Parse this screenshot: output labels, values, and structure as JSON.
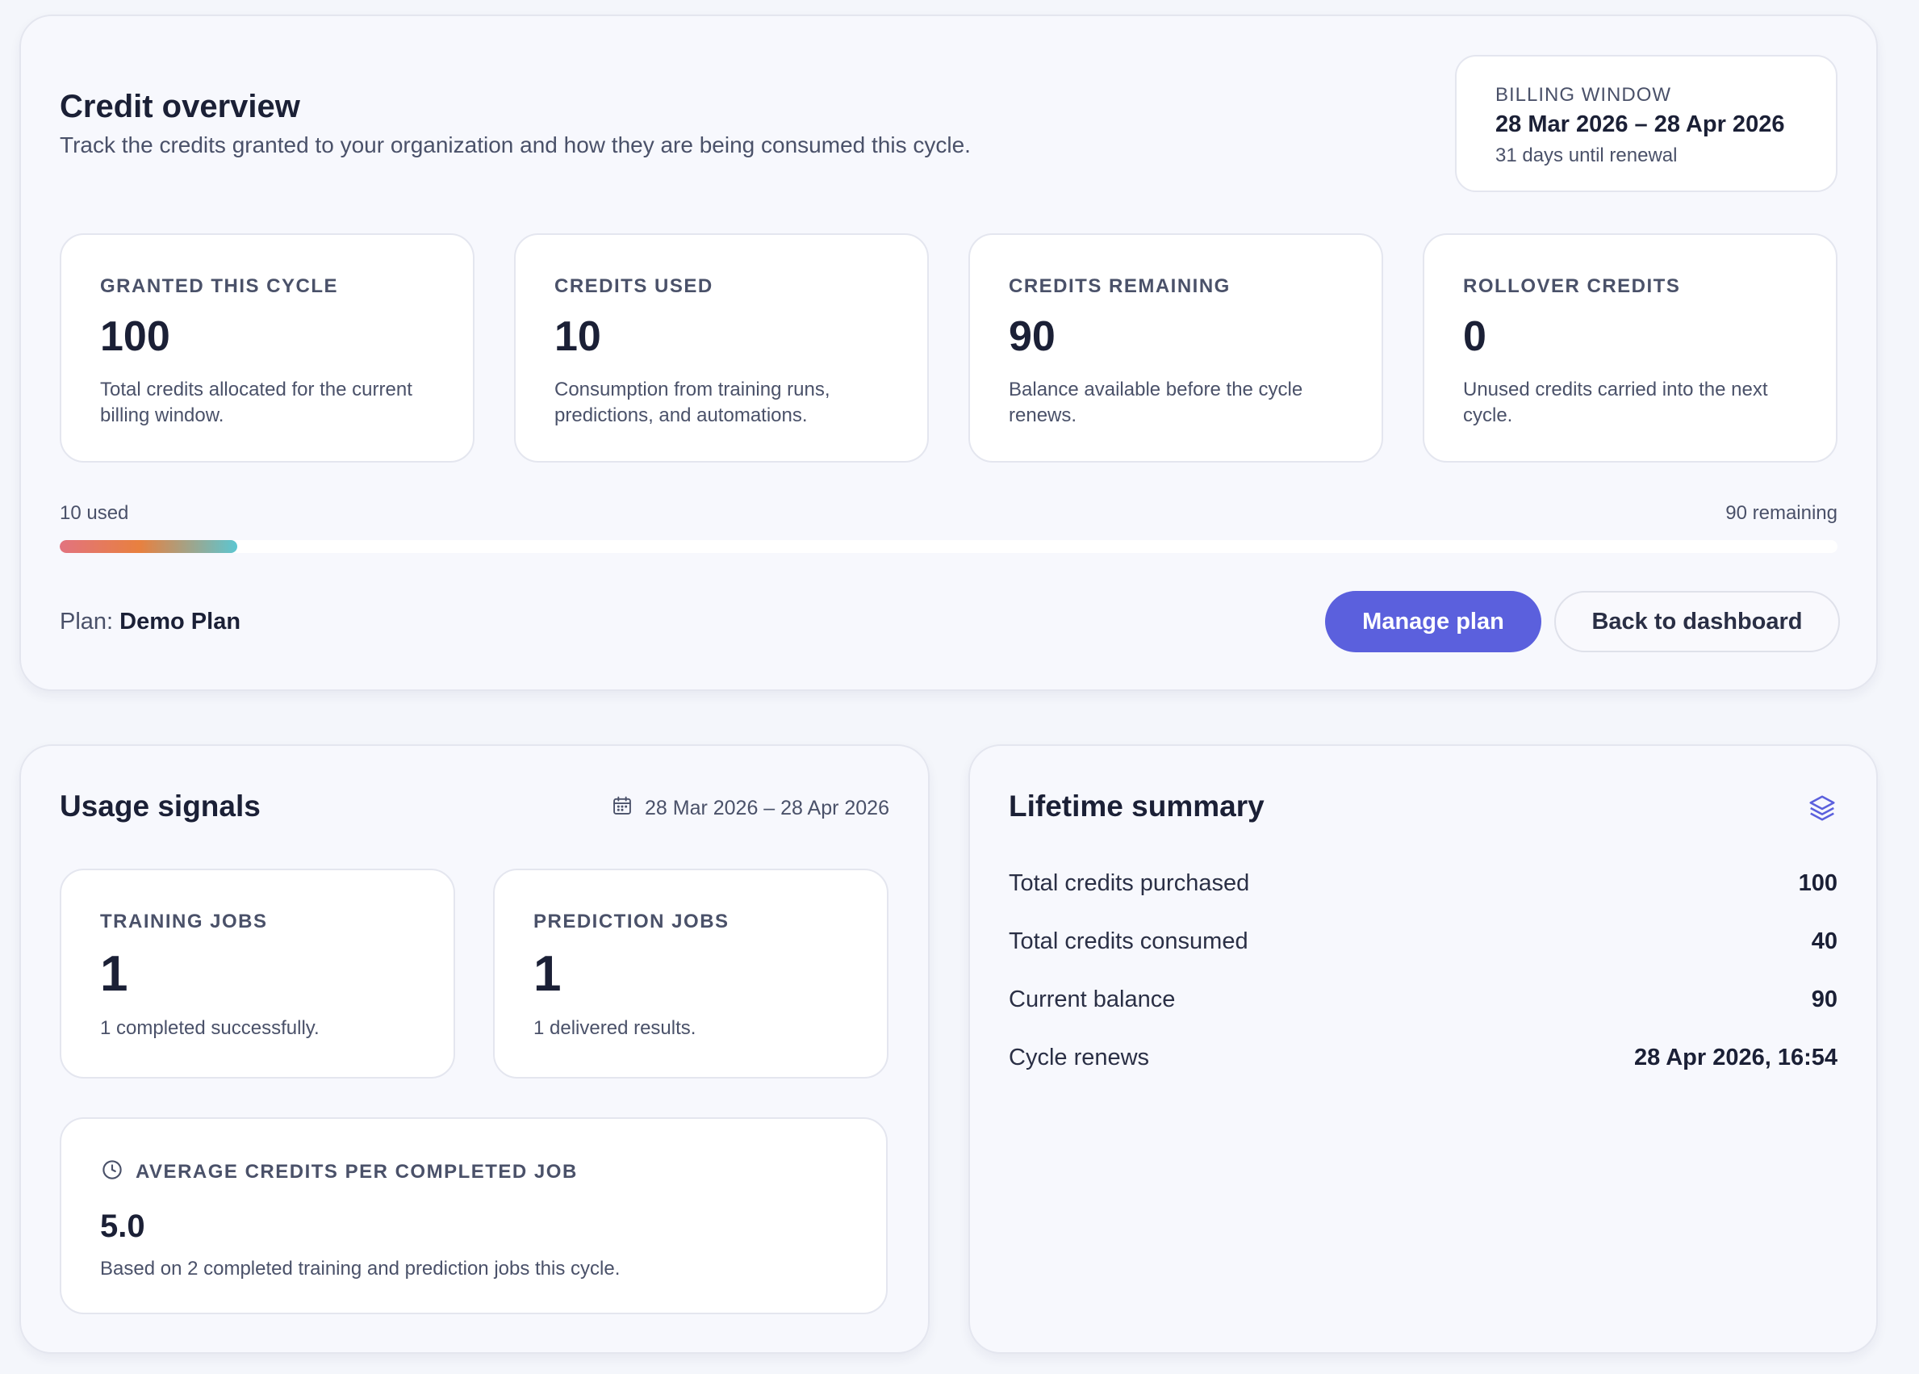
{
  "overview": {
    "title": "Credit overview",
    "subtitle": "Track the credits granted to your organization and how they are being consumed this cycle.",
    "billing": {
      "label": "BILLING WINDOW",
      "range": "28 Mar 2026 – 28 Apr 2026",
      "note": "31 days until renewal"
    },
    "stats": [
      {
        "label": "GRANTED THIS CYCLE",
        "value": "100",
        "desc": "Total credits allocated for the current billing window."
      },
      {
        "label": "CREDITS USED",
        "value": "10",
        "desc": "Consumption from training runs, predictions, and automations."
      },
      {
        "label": "CREDITS REMAINING",
        "value": "90",
        "desc": "Balance available before the cycle renews."
      },
      {
        "label": "ROLLOVER CREDITS",
        "value": "0",
        "desc": "Unused credits carried into the next cycle."
      }
    ],
    "progress": {
      "used_label": "10 used",
      "remaining_label": "90 remaining",
      "fraction_used": 0.1
    },
    "plan": {
      "prefix": "Plan:",
      "name": "Demo Plan"
    },
    "buttons": {
      "manage": "Manage plan",
      "back": "Back to dashboard"
    }
  },
  "usage": {
    "title": "Usage signals",
    "date_range": "28 Mar 2026 – 28 Apr 2026",
    "training": {
      "label": "TRAINING JOBS",
      "value": "1",
      "desc": "1 completed successfully."
    },
    "prediction": {
      "label": "PREDICTION JOBS",
      "value": "1",
      "desc": "1 delivered results."
    },
    "average": {
      "label": "AVERAGE CREDITS PER COMPLETED JOB",
      "value": "5.0",
      "desc": "Based on 2 completed training and prediction jobs this cycle."
    }
  },
  "lifetime": {
    "title": "Lifetime summary",
    "rows": [
      {
        "label": "Total credits purchased",
        "value": "100"
      },
      {
        "label": "Total credits consumed",
        "value": "40"
      },
      {
        "label": "Current balance",
        "value": "90"
      },
      {
        "label": "Cycle renews",
        "value": "28 Apr 2026, 16:54"
      }
    ]
  },
  "colors": {
    "accent": "#5b60dd",
    "progress_gradient": [
      "#e2737f",
      "#e8803f",
      "#5cc6d1"
    ]
  },
  "icons": {
    "date": "calendar-icon",
    "average": "clock-icon",
    "lifetime": "layers-icon"
  }
}
